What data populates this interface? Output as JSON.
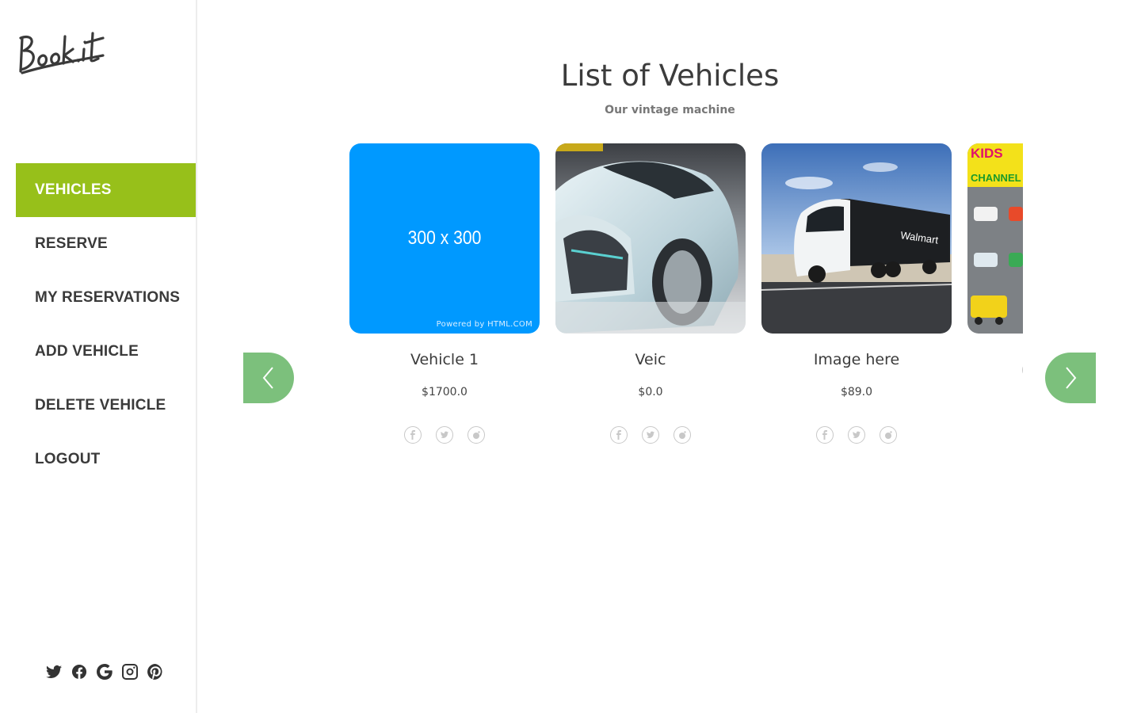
{
  "brand": {
    "logo_text": "Book.it"
  },
  "sidebar": {
    "items": [
      {
        "label": "VEHICLES",
        "active": true
      },
      {
        "label": "RESERVE",
        "active": false
      },
      {
        "label": "MY RESERVATIONS",
        "active": false
      },
      {
        "label": "ADD VEHICLE",
        "active": false
      },
      {
        "label": "DELETE VEHICLE",
        "active": false
      },
      {
        "label": "LOGOUT",
        "active": false
      }
    ],
    "social_icons": [
      "twitter-icon",
      "facebook-icon",
      "google-icon",
      "instagram-icon",
      "pinterest-icon"
    ]
  },
  "main": {
    "title": "List of Vehicles",
    "subtitle": "Our vintage machine",
    "vehicles": [
      {
        "name": "Vehicle 1",
        "price": "$1700.0",
        "image": "placeholder",
        "placeholder_text": "300 x 300",
        "placeholder_footer": "Powered by HTML.COM"
      },
      {
        "name": "Veic",
        "price": "$0.0",
        "image": "concept-car-photo"
      },
      {
        "name": "Image here",
        "price": "$89.0",
        "image": "walmart-truck-photo"
      },
      {
        "name": "",
        "price": "",
        "image": "kids-tv-toy-cars-photo",
        "image_text": "KIDS TV CHANNEL"
      }
    ],
    "card_social_icons": [
      "facebook-icon",
      "twitter-icon",
      "reddit-icon"
    ]
  },
  "colors": {
    "active_nav": "#97c01a",
    "arrow_button": "#7cc07c",
    "placeholder_blue": "#0099ff"
  }
}
